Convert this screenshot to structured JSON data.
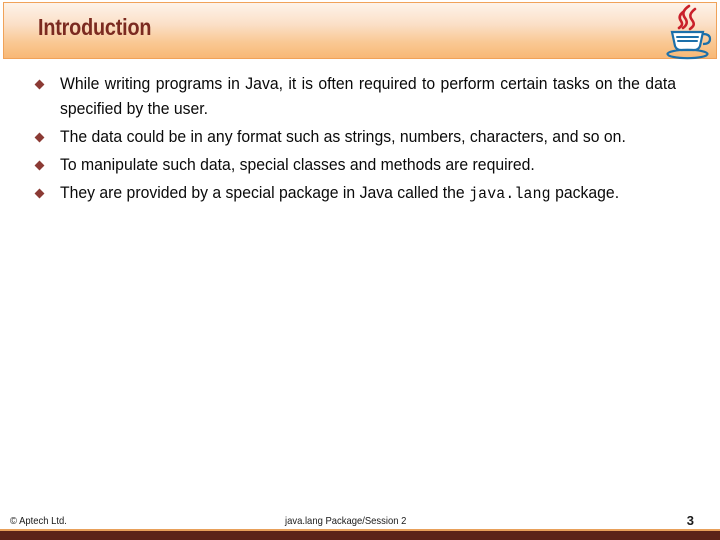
{
  "slide": {
    "title": "Introduction",
    "logo_icon": "java-coffee-cup-logo",
    "accent_header_start": "#fdf3ea",
    "accent_header_end": "#f8b876",
    "title_color": "#7b2a20",
    "bullet_color": "#8b3a34",
    "footer_bar_color": "#5c2318",
    "footer_rule_color": "#e8a05a"
  },
  "bullets": [
    {
      "marker": "diamond-bullet-icon",
      "text": "While writing programs in Java, it is often required to perform certain tasks on the data specified by the user."
    },
    {
      "marker": "diamond-bullet-icon",
      "text": "The data could be in any format such as strings, numbers, characters, and so on."
    },
    {
      "marker": "diamond-bullet-icon",
      "text": "To manipulate such data, special classes and methods are required."
    },
    {
      "marker": "diamond-bullet-icon",
      "text_before_code": "They are provided by a special package in Java called the ",
      "code": "java.lang",
      "text_after_code": " package."
    }
  ],
  "footer": {
    "copyright": "© Aptech Ltd.",
    "center": "java.lang Package/Session 2",
    "page_number": "3"
  }
}
